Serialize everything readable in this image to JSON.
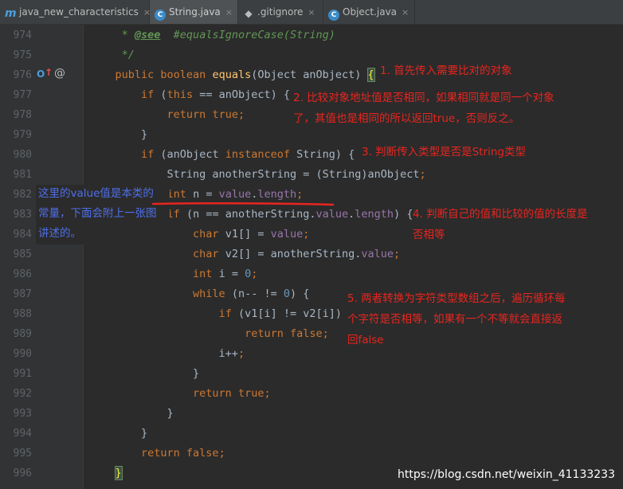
{
  "tabs": [
    {
      "label": "java_new_characteristics",
      "icon": "module-m-icon",
      "glyph": "m",
      "active": false
    },
    {
      "label": "String.java",
      "icon": "class-c-icon",
      "glyph": "C",
      "active": true
    },
    {
      "label": ".gitignore",
      "icon": "gitignore-icon",
      "glyph": "◆",
      "active": false
    },
    {
      "label": "Object.java",
      "icon": "class-c-icon",
      "glyph": "C",
      "active": false
    }
  ],
  "close_glyph": "×",
  "gutter_icons": {
    "override": "O",
    "up_arrow": "↑",
    "annotation": "@"
  },
  "lines": [
    {
      "n": "974",
      "text": "     * @see  #equalsIgnoreCase(String)"
    },
    {
      "n": "975",
      "text": "     */"
    },
    {
      "n": "976",
      "text": "    public boolean equals(Object anObject) {"
    },
    {
      "n": "977",
      "text": "        if (this == anObject) {"
    },
    {
      "n": "978",
      "text": "            return true;"
    },
    {
      "n": "979",
      "text": "        }"
    },
    {
      "n": "980",
      "text": "        if (anObject instanceof String) {"
    },
    {
      "n": "981",
      "text": "            String anotherString = (String)anObject;"
    },
    {
      "n": "982",
      "text": "            int n = value.length;"
    },
    {
      "n": "983",
      "text": "            if (n == anotherString.value.length) {"
    },
    {
      "n": "984",
      "text": "                char v1[] = value;"
    },
    {
      "n": "985",
      "text": "                char v2[] = anotherString.value;"
    },
    {
      "n": "986",
      "text": "                int i = 0;"
    },
    {
      "n": "987",
      "text": "                while (n-- != 0) {"
    },
    {
      "n": "988",
      "text": "                    if (v1[i] != v2[i])"
    },
    {
      "n": "989",
      "text": "                        return false;"
    },
    {
      "n": "990",
      "text": "                    i++;"
    },
    {
      "n": "991",
      "text": "                }"
    },
    {
      "n": "992",
      "text": "                return true;"
    },
    {
      "n": "993",
      "text": "            }"
    },
    {
      "n": "994",
      "text": "        }"
    },
    {
      "n": "995",
      "text": "        return false;"
    },
    {
      "n": "996",
      "text": "    }"
    }
  ],
  "annotations": {
    "a1": "1. 首先传入需要比对的对象",
    "a2_l1": "2. 比较对象地址值是否相同，如果相同就是同一个对象",
    "a2_l2": "了，其值也是相同的所以返回true，否则反之。",
    "a3": "3. 判断传入类型是否是String类型",
    "a4_l1": "4. 判断自己的值和比较的值的长度是",
    "a4_l2": "否相等",
    "a5_l1": "5. 两者转换为字符类型数组之后，遍历循环每",
    "a5_l2": "个字符是否相等，如果有一个不等就会直接返",
    "a5_l3": "回false",
    "blue_l1": "这里的value值是本类的",
    "blue_l2": "常量，下面会附上一张图",
    "blue_l3": "讲述的。"
  },
  "watermark": "https://blog.csdn.net/weixin_41133233",
  "colors": {
    "background": "#2b2b2b",
    "keyword": "#cc7832",
    "field": "#9876aa",
    "number": "#6897bb",
    "annotation_red": "#e8251f",
    "annotation_blue": "#4f6fe8"
  }
}
